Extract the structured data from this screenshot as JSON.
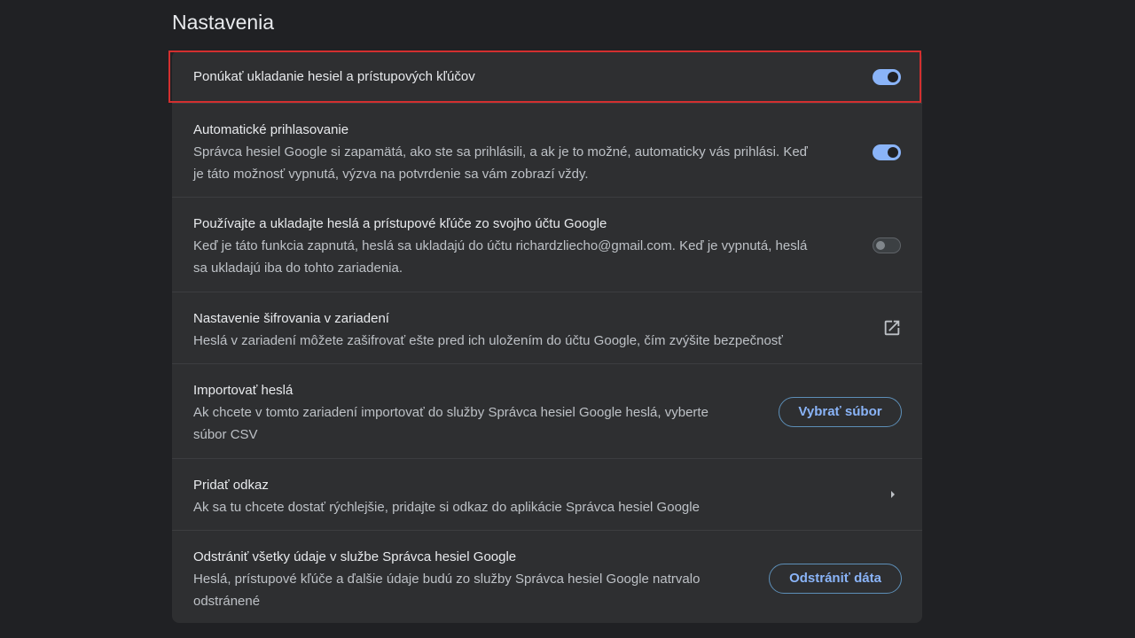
{
  "page": {
    "title": "Nastavenia"
  },
  "settings": {
    "offer_save": {
      "title": "Ponúkať ukladanie hesiel a prístupových kľúčov",
      "enabled": true
    },
    "auto_signin": {
      "title": "Automatické prihlasovanie",
      "desc_line1": "Správca hesiel Google si zapamätá, ako ste sa prihlásili, a ak je to možné, automaticky vás prihlási. Keď",
      "desc_line2": "je táto možnosť vypnutá, výzva na potvrdenie sa vám zobrazí vždy.",
      "enabled": true
    },
    "account_storage": {
      "title": "Používajte a ukladajte heslá a prístupové kľúče zo svojho účtu Google",
      "desc_line1": "Keď je táto funkcia zapnutá, heslá sa ukladajú do účtu richardzliecho@gmail.com. Keď je vypnutá, heslá",
      "desc_line2": "sa ukladajú iba do tohto zariadenia.",
      "enabled": false
    },
    "encryption": {
      "title": "Nastavenie šifrovania v zariadení",
      "desc_line1": "Heslá v zariadení môžete zašifrovať ešte pred ich uložením do účtu Google, čím zvýšite bezpečnosť",
      "icon": "external-link-icon"
    },
    "import": {
      "title": "Importovať heslá",
      "desc_line1": "Ak chcete v tomto zariadení importovať do služby Správca hesiel Google heslá, vyberte",
      "desc_line2": "súbor CSV",
      "button_label": "Vybrať súbor"
    },
    "shortcut": {
      "title": "Pridať odkaz",
      "desc_line1": "Ak sa tu chcete dostať rýchlejšie, pridajte si odkaz do aplikácie Správca hesiel Google",
      "icon": "chevron-right-icon"
    },
    "delete": {
      "title": "Odstrániť všetky údaje v službe Správca hesiel Google",
      "desc_line1": "Heslá, prístupové kľúče a ďalšie údaje budú zo služby Správca hesiel Google natrvalo",
      "desc_line2": "odstránené",
      "button_label": "Odstrániť dáta"
    }
  },
  "colors": {
    "background": "#202124",
    "card": "#2e2f31",
    "accent": "#8ab4f8",
    "highlight": "#d32f2f"
  }
}
